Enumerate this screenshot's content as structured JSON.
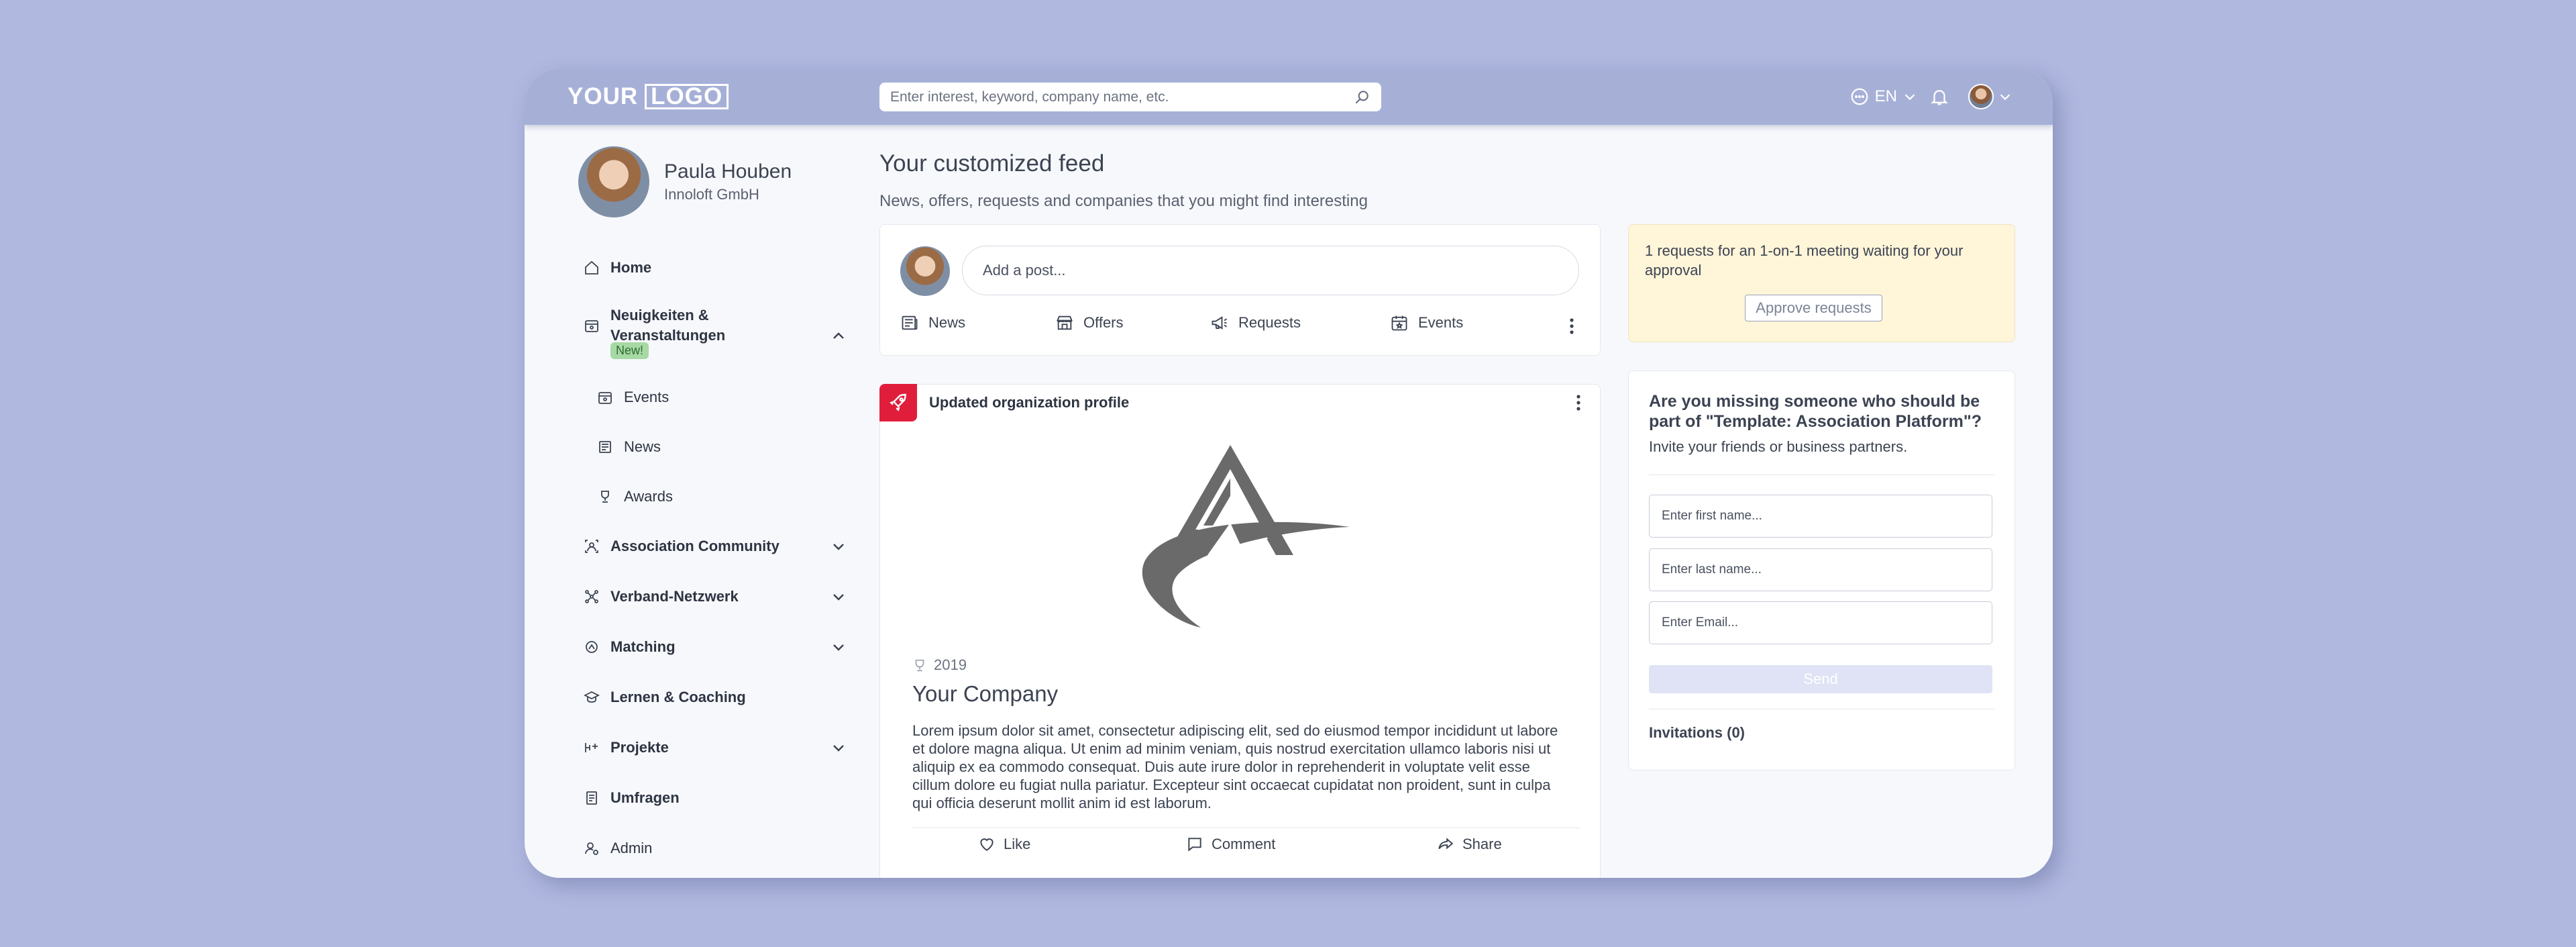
{
  "topbar": {
    "logo_left": "YOUR",
    "logo_right": "LOGO",
    "search_placeholder": "Enter interest, keyword, company name, etc.",
    "language": "EN"
  },
  "profile": {
    "name": "Paula Houben",
    "company": "Innoloft GmbH"
  },
  "sidebar": {
    "items": [
      {
        "label": "Home"
      },
      {
        "label": "Neuigkeiten & Veranstaltungen",
        "badge": "New!"
      },
      {
        "label": "Events"
      },
      {
        "label": "News"
      },
      {
        "label": "Awards"
      },
      {
        "label": "Association Community"
      },
      {
        "label": "Verband-Netzwerk"
      },
      {
        "label": "Matching"
      },
      {
        "label": "Lernen & Coaching"
      },
      {
        "label": "Projekte"
      },
      {
        "label": "Umfragen"
      },
      {
        "label": "Admin"
      }
    ]
  },
  "feed": {
    "title": "Your customized feed",
    "subtitle": "News, offers, requests and companies that you might find interesting",
    "composer": {
      "placeholder": "Add a post...",
      "actions": [
        "News",
        "Offers",
        "Requests",
        "Events"
      ]
    },
    "post": {
      "header": "Updated organization profile",
      "year": "2019",
      "company": "Your Company",
      "description": "Lorem ipsum dolor sit amet, consectetur adipiscing elit, sed do eiusmod tempor incididunt ut labore et dolore magna aliqua. Ut enim ad minim veniam, quis nostrud exercitation ullamco laboris nisi ut aliquip ex ea commodo consequat. Duis aute irure dolor in reprehenderit in voluptate velit esse cillum dolore eu fugiat nulla pariatur. Excepteur sint occaecat cupidatat non proident, sunt in culpa qui officia deserunt mollit anim id est laborum.",
      "actions": [
        "Like",
        "Comment",
        "Share"
      ]
    }
  },
  "notice": {
    "text": "1 requests for an 1-on-1 meeting waiting for your approval",
    "button": "Approve requests"
  },
  "invite": {
    "question": "Are you missing someone who should be part of \"Template: Association Platform\"?",
    "subtitle": "Invite your friends or business partners.",
    "first_name_placeholder": "Enter first name...",
    "last_name_placeholder": "Enter last name...",
    "email_placeholder": "Enter Email...",
    "send": "Send",
    "invitations": "Invitations (0)"
  },
  "colors": {
    "background": "#b0b8e0",
    "topbar": "#a6b0d7",
    "accent_red": "#e01e3c",
    "notice_bg": "#fff5d9",
    "badge_green": "#a6d9a3"
  }
}
